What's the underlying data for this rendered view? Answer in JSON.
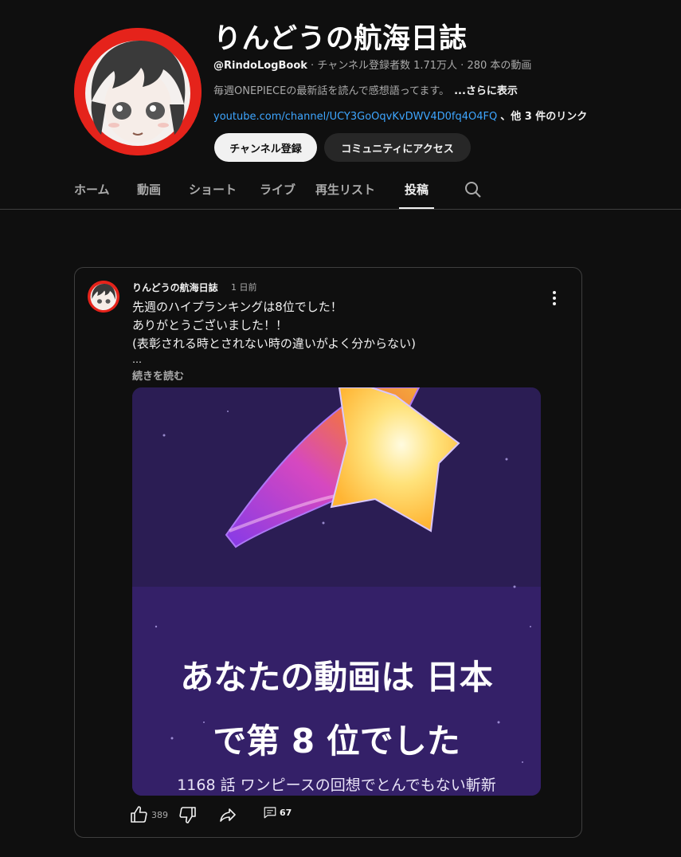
{
  "channel": {
    "title": "りんどうの航海日誌",
    "handle": "@RindoLogBook",
    "subscribers": "チャンネル登録者数 1.71万人",
    "video_count": "280 本の動画",
    "separator": "·",
    "description": "毎週ONEPIECEの最新話を読んで感想語ってます。",
    "description_more": "...さらに表示",
    "link": "youtube.com/channel/UCY3GoOqvKvDWV4D0fq4O4FQ",
    "link_more": "、他 3 件のリンク",
    "subscribe_button": "チャンネル登録",
    "community_button": "コミュニティにアクセス"
  },
  "tabs": [
    {
      "label": "ホーム",
      "active": false
    },
    {
      "label": "動画",
      "active": false
    },
    {
      "label": "ショート",
      "active": false
    },
    {
      "label": "ライブ",
      "active": false
    },
    {
      "label": "再生リスト",
      "active": false
    },
    {
      "label": "投稿",
      "active": true
    }
  ],
  "post": {
    "author": "りんどうの航海日誌",
    "time": "1 日前",
    "lines": [
      "先週のハイプランキングは8位でした！",
      "ありがとうございました！！",
      "(表彰される時とされない時の違いがよく分からない)"
    ],
    "ellipsis": "…",
    "read_more": "続きを読む",
    "image": {
      "line1": "あなたの動画は 日本",
      "line2": "で第 8 位でした",
      "line3": "1168 話 ワンピースの回想でとんでもない斬新"
    },
    "likes": "389",
    "comments": "67"
  },
  "icons": {
    "search": "search-icon",
    "menu": "more-vert-icon",
    "like": "thumb-up-icon",
    "dislike": "thumb-down-icon",
    "share": "share-icon",
    "comment": "comment-icon"
  },
  "colors": {
    "background": "#0f0f0f",
    "link": "#3ea6ff",
    "avatar_ring": "#e5231b"
  }
}
